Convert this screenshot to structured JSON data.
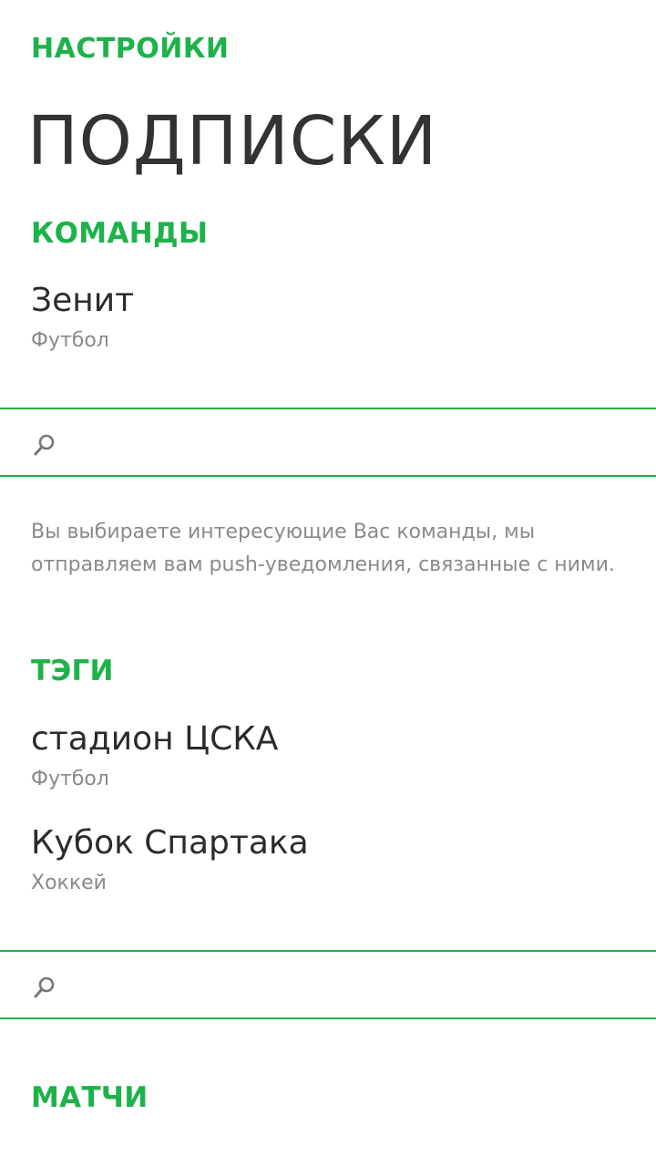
{
  "app_title": "НАСТРОЙКИ",
  "page_title": "ПОДПИСКИ",
  "teams": {
    "header": "КОМАНДЫ",
    "items": [
      {
        "title": "Зенит",
        "subtitle": "Футбол"
      }
    ],
    "search": {
      "value": "",
      "placeholder": ""
    },
    "description": "Вы выбираете интересующие Вас команды, мы отправляем вам push-уведомления, связанные с ними."
  },
  "tags": {
    "header": "ТЭГИ",
    "items": [
      {
        "title": "стадион ЦСКА",
        "subtitle": "Футбол"
      },
      {
        "title": "Кубок Спартака",
        "subtitle": "Хоккей"
      }
    ],
    "search": {
      "value": "",
      "placeholder": ""
    }
  },
  "matches": {
    "header": "МАТЧИ"
  },
  "colors": {
    "accent": "#1db24a",
    "text_primary": "#2b2b2b",
    "text_secondary": "#8a8a8a",
    "background": "#ffffff"
  },
  "icons": [
    "search-icon"
  ]
}
